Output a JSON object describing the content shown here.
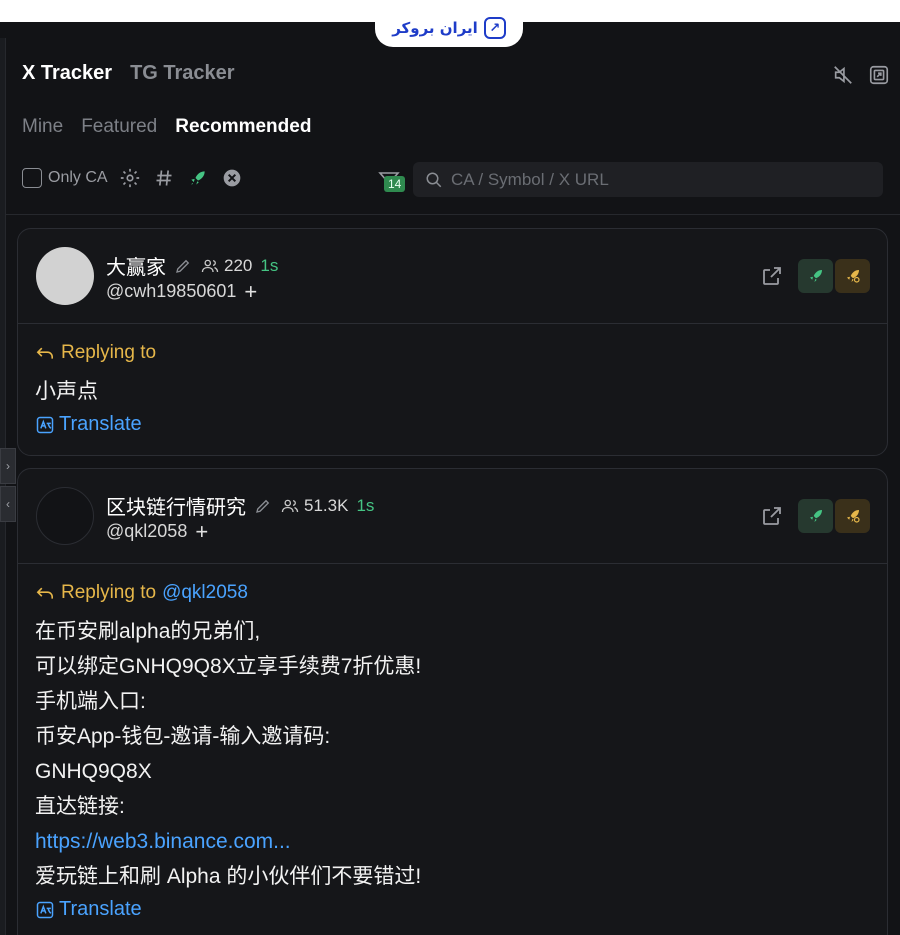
{
  "watermark": {
    "text": "ایران بروکر"
  },
  "header": {
    "tabs": [
      {
        "label": "X Tracker",
        "active": true
      },
      {
        "label": "TG Tracker",
        "active": false
      }
    ],
    "icons": [
      "mute-icon",
      "popout-icon"
    ]
  },
  "subtabs": [
    {
      "label": "Mine",
      "active": false
    },
    {
      "label": "Featured",
      "active": false
    },
    {
      "label": "Recommended",
      "active": true
    }
  ],
  "filters": {
    "only_ca_label": "Only CA",
    "icons": [
      "gear-icon",
      "hash-icon",
      "rocket-icon",
      "xx-icon"
    ]
  },
  "notification": {
    "count": "14"
  },
  "search": {
    "placeholder": "CA / Symbol / X URL",
    "value": ""
  },
  "colors": {
    "accent_green": "#45c483",
    "reply_gold": "#e6b74a",
    "link_blue": "#4aa3ff"
  },
  "posts": [
    {
      "name": "大赢家",
      "followers": "220",
      "time": "1s",
      "handle": "@cwh19850601",
      "avatar_color": "#d2d2d2",
      "replying_to": "Replying to",
      "reply_mention": "",
      "lines": [
        "小声点"
      ],
      "link": "",
      "lines_after": [],
      "translate": "Translate"
    },
    {
      "name": "区块链行情研究",
      "followers": "51.3K",
      "time": "1s",
      "handle": "@qkl2058",
      "avatar_color": "#121316",
      "replying_to": "Replying to",
      "reply_mention": "@qkl2058",
      "lines": [
        "在币安刷alpha的兄弟们,",
        "可以绑定GNHQ9Q8X立享手续费7折优惠!",
        "手机端入口:",
        "币安App-钱包-邀请-输入邀请码:",
        "GNHQ9Q8X",
        "直达链接:"
      ],
      "link": "https://web3.binance.com...",
      "lines_after": [
        "爱玩链上和刷 Alpha 的小伙伴们不要错过!"
      ],
      "translate": "Translate"
    }
  ]
}
